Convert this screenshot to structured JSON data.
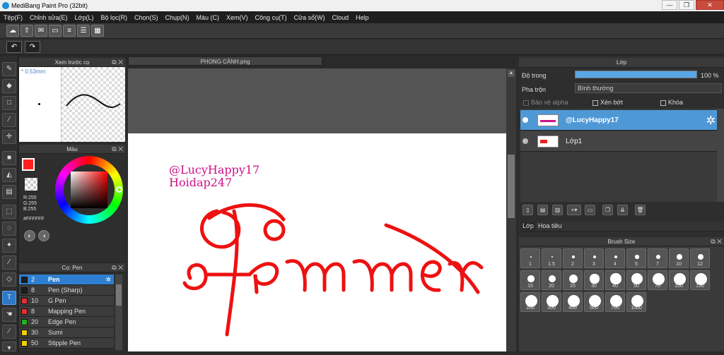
{
  "app": {
    "title": "MediBang Paint Pro (32bit)"
  },
  "window_controls": {
    "minimize": "—",
    "maximize": "❐",
    "close": "✕"
  },
  "menu": [
    "Tệp(F)",
    "Chỉnh sửa(E)",
    "Lớp(L)",
    "Bộ lọc(R)",
    "Chọn(S)",
    "Chụp(N)",
    "Màu (C)",
    "Xem(V)",
    "Công cụ(T)",
    "Cửa sổ(W)",
    "Cloud",
    "Help"
  ],
  "preview_panel": {
    "title": "Xem trước cọ",
    "size": "0.53mm"
  },
  "color_panel": {
    "title": "Màu",
    "r": "R:255",
    "g": "G:255",
    "b": "B:255",
    "hex": "#FFFFFF",
    "fg_color": "#ff2020"
  },
  "brush_panel": {
    "title": "Cọ: Pen",
    "items": [
      {
        "size": "2",
        "name": "Pen",
        "color": "#1d1d1d",
        "selected": true
      },
      {
        "size": "8",
        "name": "Pen (Sharp)",
        "color": "#1d1d1d"
      },
      {
        "size": "10",
        "name": "G Pen",
        "color": "#e03030"
      },
      {
        "size": "8",
        "name": "Mapping Pen",
        "color": "#e03030"
      },
      {
        "size": "20",
        "name": "Edge Pen",
        "color": "#20b020"
      },
      {
        "size": "30",
        "name": "Sumi",
        "color": "#f0d000"
      },
      {
        "size": "50",
        "name": "Stipple Pen",
        "color": "#f0d000"
      }
    ]
  },
  "document": {
    "tab": "PHONG CẢNH.png",
    "line1": "@LucyHappy17",
    "line2": "Hoidap247",
    "ink_color": "#ee1111",
    "handle_color": "#cc1188"
  },
  "layer_panel": {
    "title": "Lớp",
    "opacity_label": "Độ trong",
    "opacity_value": "100 %",
    "opacity": 1.0,
    "blend_label": "Pha trộn",
    "blend_value": "Bình thường",
    "protect_alpha": "Bảo vệ alpha",
    "clip": "Xén bớt",
    "lock": "Khóa",
    "layers": [
      {
        "name": "@LucyHappy17",
        "selected": true
      },
      {
        "name": "Lớp1",
        "selected": false
      }
    ],
    "tabs": [
      "Lớp",
      "Hoa tiêu"
    ]
  },
  "brush_size_panel": {
    "title": "Brush Size",
    "sizes": [
      "1",
      "1.5",
      "2",
      "3",
      "4",
      "5",
      "7",
      "10",
      "12",
      "15",
      "20",
      "25",
      "30",
      "40",
      "50",
      "70",
      "100",
      "150",
      "200",
      "300",
      "400",
      "500",
      "700",
      "1000"
    ]
  },
  "colors": {
    "accent": "#2f7fd0",
    "panel": "#2e2e2e"
  }
}
